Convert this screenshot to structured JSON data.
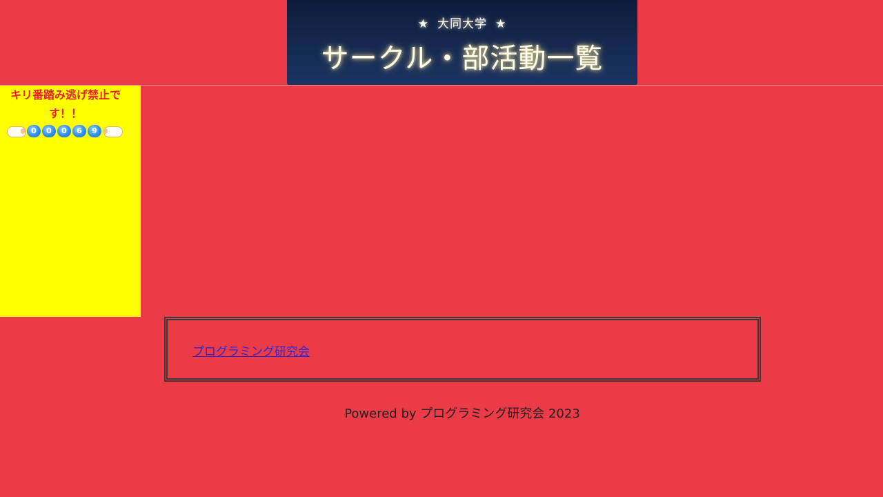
{
  "banner": {
    "subtitle": "大同大学",
    "star": "★",
    "title": "サークル・部活動一覧"
  },
  "sidebar": {
    "notice": "キリ番踏み逃げ禁止です！！",
    "counter_digits": [
      "0",
      "0",
      "0",
      "6",
      "9"
    ],
    "counter_icon": "blue-speech-bubble-digit",
    "counter_deco_icon": "sheep-icon"
  },
  "clubs": {
    "links": [
      {
        "label": "プログラミング研究会"
      }
    ]
  },
  "footer": {
    "text": "Powered by プログラミング研究会 2023"
  },
  "colors": {
    "background": "#EB3B47",
    "sidebar": "#FFFF00",
    "banner_top": "#0E1C3A",
    "banner_bottom": "#1B3463",
    "notice_text": "#E8202A",
    "link": "#2B2BD8"
  }
}
